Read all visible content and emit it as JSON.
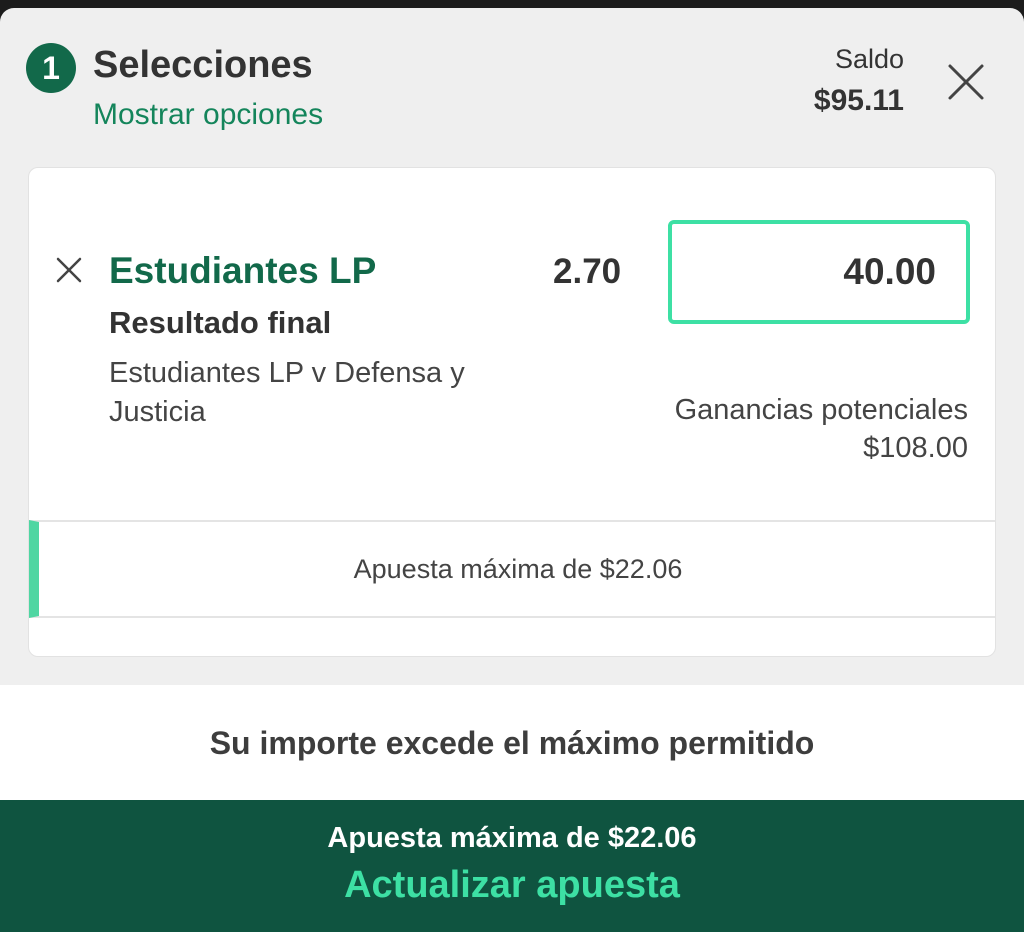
{
  "header": {
    "count": "1",
    "title": "Selecciones",
    "show_options": "Mostrar opciones",
    "balance_label": "Saldo",
    "balance_value": "$95.11"
  },
  "selection": {
    "team": "Estudiantes LP",
    "market": "Resultado final",
    "event": "Estudiantes LP v Defensa y Justicia",
    "odds": "2.70",
    "stake": "40.00",
    "potential_label": "Ganancias potenciales",
    "potential_value": "$108.00",
    "max_notice": "Apuesta máxima de $22.06"
  },
  "error": {
    "message": "Su importe excede el máximo permitido"
  },
  "cta": {
    "sub": "Apuesta máxima de $22.06",
    "main": "Actualizar apuesta"
  },
  "icons": {
    "close": "close-icon",
    "remove": "remove-selection-icon"
  },
  "colors": {
    "brand_green": "#12694a",
    "accent_mint": "#3de0a4",
    "cta_bg": "#0f5440"
  }
}
